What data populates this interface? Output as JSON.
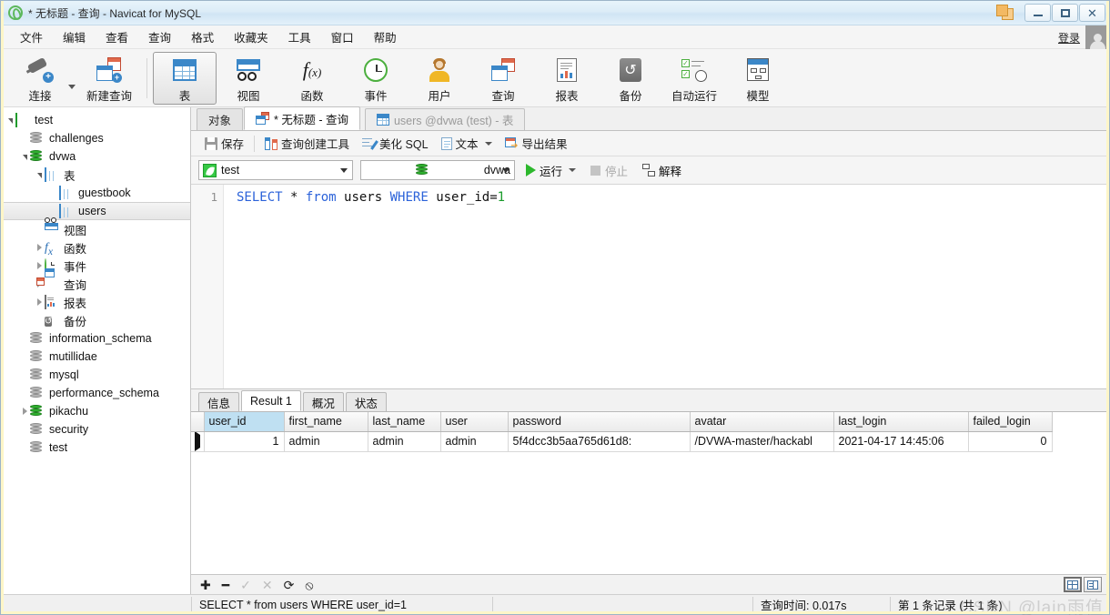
{
  "window": {
    "title": "* 无标题 - 查询 - Navicat for MySQL",
    "minimize_label": "",
    "maximize_label": "",
    "close_label": "✕"
  },
  "menubar": {
    "items": [
      "文件",
      "编辑",
      "查看",
      "查询",
      "格式",
      "收藏夹",
      "工具",
      "窗口",
      "帮助"
    ],
    "login_label": "登录"
  },
  "toolbar": {
    "items": [
      {
        "label": "连接",
        "icon": "connection-icon"
      },
      {
        "label": "新建查询",
        "icon": "new-query-icon"
      },
      {
        "label": "表",
        "icon": "table-icon"
      },
      {
        "label": "视图",
        "icon": "view-icon"
      },
      {
        "label": "函数",
        "icon": "function-icon"
      },
      {
        "label": "事件",
        "icon": "event-icon"
      },
      {
        "label": "用户",
        "icon": "user-icon"
      },
      {
        "label": "查询",
        "icon": "query-icon"
      },
      {
        "label": "报表",
        "icon": "report-icon"
      },
      {
        "label": "备份",
        "icon": "backup-icon"
      },
      {
        "label": "自动运行",
        "icon": "automation-icon"
      },
      {
        "label": "模型",
        "icon": "model-icon"
      }
    ],
    "active_index": 2
  },
  "sidebar": {
    "items": [
      {
        "label": "test",
        "icon": "navicat-leaf-icon",
        "indent": 0,
        "twisty": "open",
        "selected": false
      },
      {
        "label": "challenges",
        "icon": "database-gray-icon",
        "indent": 1,
        "twisty": "none",
        "selected": false
      },
      {
        "label": "dvwa",
        "icon": "database-green-icon",
        "indent": 1,
        "twisty": "open",
        "selected": false
      },
      {
        "label": "表",
        "icon": "table-icon",
        "indent": 2,
        "twisty": "open",
        "selected": false
      },
      {
        "label": "guestbook",
        "icon": "table-icon",
        "indent": 3,
        "twisty": "none",
        "selected": false
      },
      {
        "label": "users",
        "icon": "table-icon",
        "indent": 3,
        "twisty": "none",
        "selected": true
      },
      {
        "label": "视图",
        "icon": "view-icon",
        "indent": 2,
        "twisty": "none",
        "selected": false
      },
      {
        "label": "函数",
        "icon": "function-icon",
        "indent": 2,
        "twisty": "closed",
        "selected": false
      },
      {
        "label": "事件",
        "icon": "event-icon",
        "indent": 2,
        "twisty": "closed",
        "selected": false
      },
      {
        "label": "查询",
        "icon": "query-icon",
        "indent": 2,
        "twisty": "closed",
        "selected": false
      },
      {
        "label": "报表",
        "icon": "report-icon",
        "indent": 2,
        "twisty": "closed",
        "selected": false
      },
      {
        "label": "备份",
        "icon": "backup-icon",
        "indent": 2,
        "twisty": "none",
        "selected": false
      },
      {
        "label": "information_schema",
        "icon": "database-gray-icon",
        "indent": 1,
        "twisty": "none",
        "selected": false
      },
      {
        "label": "mutillidae",
        "icon": "database-gray-icon",
        "indent": 1,
        "twisty": "none",
        "selected": false
      },
      {
        "label": "mysql",
        "icon": "database-gray-icon",
        "indent": 1,
        "twisty": "none",
        "selected": false
      },
      {
        "label": "performance_schema",
        "icon": "database-gray-icon",
        "indent": 1,
        "twisty": "none",
        "selected": false
      },
      {
        "label": "pikachu",
        "icon": "database-green-icon",
        "indent": 1,
        "twisty": "closed",
        "selected": false
      },
      {
        "label": "security",
        "icon": "database-gray-icon",
        "indent": 1,
        "twisty": "none",
        "selected": false
      },
      {
        "label": "test",
        "icon": "database-gray-icon",
        "indent": 1,
        "twisty": "none",
        "selected": false
      }
    ]
  },
  "tabs": [
    {
      "label": "对象",
      "icon": "none",
      "state": "inactive"
    },
    {
      "label": "* 无标题 - 查询",
      "icon": "query-icon",
      "state": "active"
    },
    {
      "label": "users @dvwa (test) - 表",
      "icon": "table-icon",
      "state": "muted"
    }
  ],
  "query_toolbar": {
    "save": "保存",
    "query_builder": "查询创建工具",
    "beautify_sql": "美化 SQL",
    "text": "文本",
    "export_result": "导出结果"
  },
  "connection_bar": {
    "connection": "test",
    "database": "dvwa",
    "run": "运行",
    "stop": "停止",
    "explain": "解释"
  },
  "editor": {
    "line_number": "1",
    "sql_tokens": [
      {
        "text": "SELECT",
        "type": "kw"
      },
      {
        "text": " * ",
        "type": "op"
      },
      {
        "text": "from",
        "type": "kw"
      },
      {
        "text": " users ",
        "type": "op"
      },
      {
        "text": "WHERE",
        "type": "kw"
      },
      {
        "text": " user_id=",
        "type": "op"
      },
      {
        "text": "1",
        "type": "num"
      }
    ]
  },
  "result": {
    "tabs": [
      "信息",
      "Result 1",
      "概况",
      "状态"
    ],
    "active_tab": "Result 1",
    "columns": [
      "user_id",
      "first_name",
      "last_name",
      "user",
      "password",
      "avatar",
      "last_login",
      "failed_login"
    ],
    "selected_column": "user_id",
    "rows": [
      {
        "user_id": "1",
        "first_name": "admin",
        "last_name": "admin",
        "user": "admin",
        "password": "5f4dcc3b5aa765d61d8:",
        "avatar": "/DVWA-master/hackabl",
        "last_login": "2021-04-17 14:45:06",
        "failed_login": "0"
      }
    ],
    "grid_toolbar_icons": [
      "add-record-icon",
      "delete-record-icon",
      "apply-change-icon",
      "discard-change-icon",
      "refresh-icon",
      "stop-icon"
    ],
    "view_toggles": [
      "grid-view-icon",
      "form-view-icon"
    ],
    "active_view": "grid-view-icon"
  },
  "sql_status": {
    "text": "SELECT * from users WHERE user_id=1"
  },
  "statusbar": {
    "query_time": "查询时间: 0.017s",
    "record_info": "第 1 条记录 (共 1 条)",
    "watermark": "CSDN @lain雨值"
  }
}
